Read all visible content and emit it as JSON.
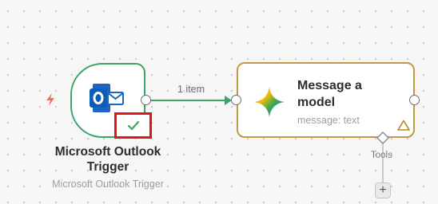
{
  "colors": {
    "trigger_border": "#3aa56a",
    "model_border": "#c39a44",
    "success_check": "#3aa56a",
    "highlight_box": "#e0141b",
    "bolt_icon": "#f36a5e",
    "warning_icon": "#b8861a"
  },
  "trigger_node": {
    "icon": "outlook-icon",
    "status_icon": "checkmark-icon",
    "trigger_indicator_icon": "lightning-bolt-icon",
    "title_line1": "Microsoft Outlook",
    "title_line2": "Trigger",
    "subtitle": "Microsoft Outlook Trigger"
  },
  "connection": {
    "label": "1 item"
  },
  "model_node": {
    "icon": "gemini-sparkle-icon",
    "title_line1": "Message a",
    "title_line2": "model",
    "subtitle": "message: text",
    "warning_icon": "warning-triangle-icon"
  },
  "tools": {
    "label": "Tools",
    "add_label": "+"
  }
}
